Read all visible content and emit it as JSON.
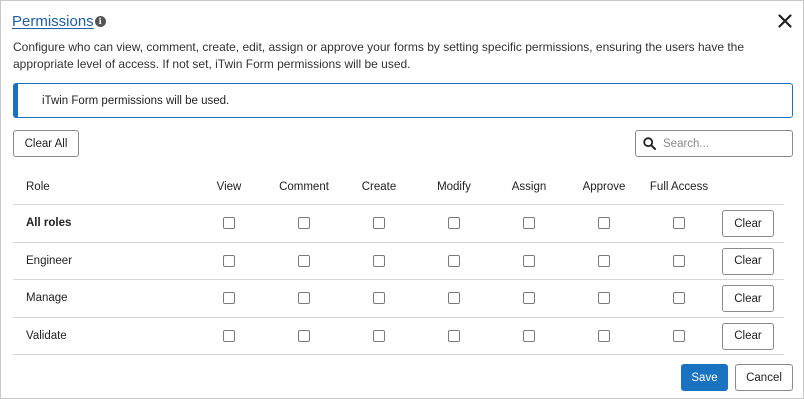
{
  "dialog": {
    "title": "Permissions",
    "info_glyph": "i",
    "description": "Configure who can view, comment, create, edit, assign or approve your forms by setting specific permissions, ensuring the users have the appropriate level of access. If not set, iTwin Form permissions will be used.",
    "banner_text": "iTwin Form permissions will be used."
  },
  "toolbar": {
    "clear_all_label": "Clear All",
    "search_placeholder": "Search...",
    "search_value": ""
  },
  "table": {
    "role_header": "Role",
    "columns": [
      "View",
      "Comment",
      "Create",
      "Modify",
      "Assign",
      "Approve",
      "Full Access"
    ],
    "rows": [
      {
        "role": "All roles",
        "checked": [
          false,
          false,
          false,
          false,
          false,
          false,
          false
        ],
        "clear_label": "Clear"
      },
      {
        "role": "Engineer",
        "checked": [
          false,
          false,
          false,
          false,
          false,
          false,
          false
        ],
        "clear_label": "Clear"
      },
      {
        "role": "Manage",
        "checked": [
          false,
          false,
          false,
          false,
          false,
          false,
          false
        ],
        "clear_label": "Clear"
      },
      {
        "role": "Validate",
        "checked": [
          false,
          false,
          false,
          false,
          false,
          false,
          false
        ],
        "clear_label": "Clear"
      }
    ]
  },
  "footer": {
    "save_label": "Save",
    "cancel_label": "Cancel"
  },
  "colors": {
    "accent": "#1a73c0",
    "title_link": "#1a5fa8"
  },
  "icons": [
    "info-icon",
    "close-icon",
    "search-icon"
  ]
}
